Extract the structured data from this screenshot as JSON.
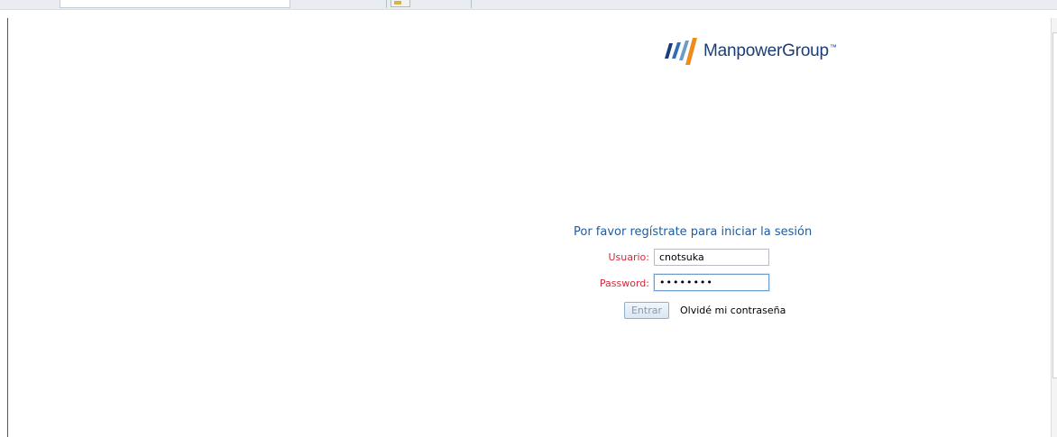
{
  "brand": {
    "name": "ManpowerGroup",
    "tm": "™",
    "logo_colors": [
      "#1c3d74",
      "#2f6eb5",
      "#6a9bc9",
      "#f08a1d"
    ]
  },
  "login": {
    "title": "Por favor regístrate para iniciar la sesión",
    "username_label": "Usuario:",
    "username_value": "cnotsuka",
    "password_label": "Password:",
    "password_value": "••••••••",
    "submit_label": "Entrar",
    "forgot_label": "Olvidé mi contraseña"
  },
  "colors": {
    "label": "#d22c3a",
    "title": "#1f5b9e",
    "brand": "#1c3d74"
  }
}
